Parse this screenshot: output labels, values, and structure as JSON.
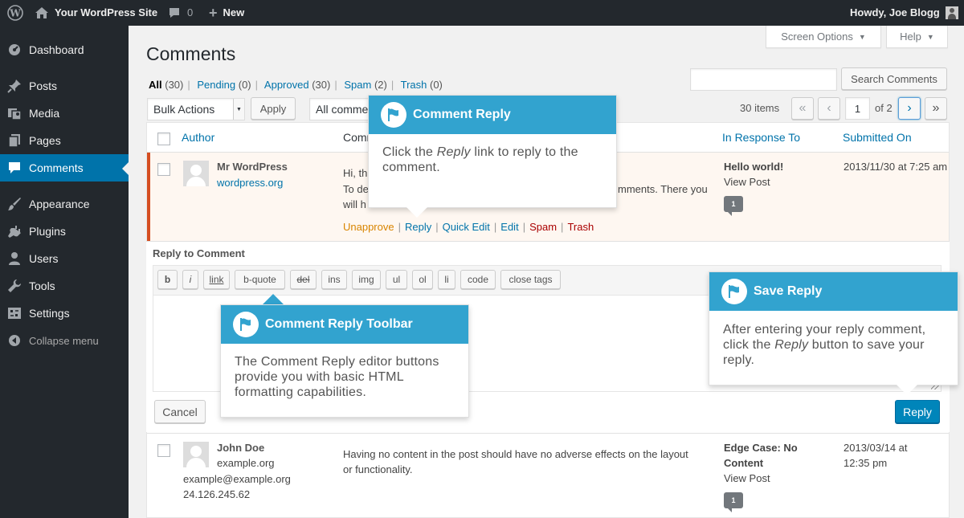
{
  "adminbar": {
    "site_name": "Your WordPress Site",
    "comments_count": "0",
    "new_label": "New",
    "howdy": "Howdy, Joe Blogg"
  },
  "sidebar": {
    "items": [
      {
        "label": "Dashboard",
        "icon": "dashboard-icon"
      },
      {
        "label": "Posts",
        "icon": "pin-icon"
      },
      {
        "label": "Media",
        "icon": "media-icon"
      },
      {
        "label": "Pages",
        "icon": "pages-icon"
      },
      {
        "label": "Comments",
        "icon": "comment-icon"
      },
      {
        "label": "Appearance",
        "icon": "brush-icon"
      },
      {
        "label": "Plugins",
        "icon": "plug-icon"
      },
      {
        "label": "Users",
        "icon": "user-icon"
      },
      {
        "label": "Tools",
        "icon": "wrench-icon"
      },
      {
        "label": "Settings",
        "icon": "settings-icon"
      },
      {
        "label": "Collapse menu",
        "icon": "collapse-icon"
      }
    ]
  },
  "top": {
    "screen_options": "Screen Options",
    "help": "Help"
  },
  "page": {
    "title": "Comments"
  },
  "filters": {
    "all": "All",
    "all_count": "(30)",
    "pending": "Pending",
    "pending_count": "(0)",
    "approved": "Approved",
    "approved_count": "(30)",
    "spam": "Spam",
    "spam_count": "(2)",
    "trash": "Trash",
    "trash_count": "(0)"
  },
  "search": {
    "button": "Search Comments",
    "value": ""
  },
  "bulk": {
    "select": "Bulk Actions",
    "apply": "Apply",
    "type_filter": "All comme"
  },
  "pagination": {
    "items": "30 items",
    "first": "«",
    "prev": "‹",
    "current": "1",
    "of": "of 2",
    "next": "›",
    "last": "»"
  },
  "columns": {
    "author": "Author",
    "comment": "Comm",
    "response": "In Response To",
    "submitted": "Submitted On"
  },
  "comment1": {
    "author": "Mr WordPress",
    "url": "wordpress.org",
    "line1": "Hi, th",
    "line2a": "To de",
    "line2b": "mments. There you",
    "line3": "will h",
    "post": "Hello world!",
    "view": "View Post",
    "bubble": "1",
    "date": "2013/11/30 at 7:25 am",
    "actions": {
      "unapprove": "Unapprove",
      "reply": "Reply",
      "quick_edit": "Quick Edit",
      "edit": "Edit",
      "spam": "Spam",
      "trash": "Trash"
    }
  },
  "reply_form": {
    "title": "Reply to Comment",
    "buttons": [
      "b",
      "i",
      "link",
      "b-quote",
      "del",
      "ins",
      "img",
      "ul",
      "ol",
      "li",
      "code",
      "close tags"
    ],
    "cancel": "Cancel",
    "reply": "Reply"
  },
  "comment2": {
    "author": "John Doe",
    "url": "example.org",
    "email": "example@example.org",
    "ip": "24.126.245.62",
    "text": "Having no content in the post should have no adverse effects on the layout or functionality.",
    "post": "Edge Case: No Content",
    "view": "View Post",
    "bubble": "1",
    "date": "2013/03/14 at 12:35 pm"
  },
  "pointers": {
    "reply": {
      "title": "Comment Reply",
      "pre": "Click the ",
      "em": "Reply",
      "post": " link to reply to the comment."
    },
    "toolbar": {
      "title": "Comment Reply Toolbar",
      "text": "The Comment Reply editor buttons provide you with basic HTML formatting capabilities."
    },
    "save": {
      "title": "Save Reply",
      "pre": "After entering your reply comment, click the ",
      "em": "Reply",
      "post": " button to save your reply."
    }
  },
  "colors": {
    "accent": "#0073aa",
    "pointer_header": "#32a3cf",
    "admin_bg": "#23282d",
    "unapprove": "#d98500",
    "spam": "#a00"
  }
}
